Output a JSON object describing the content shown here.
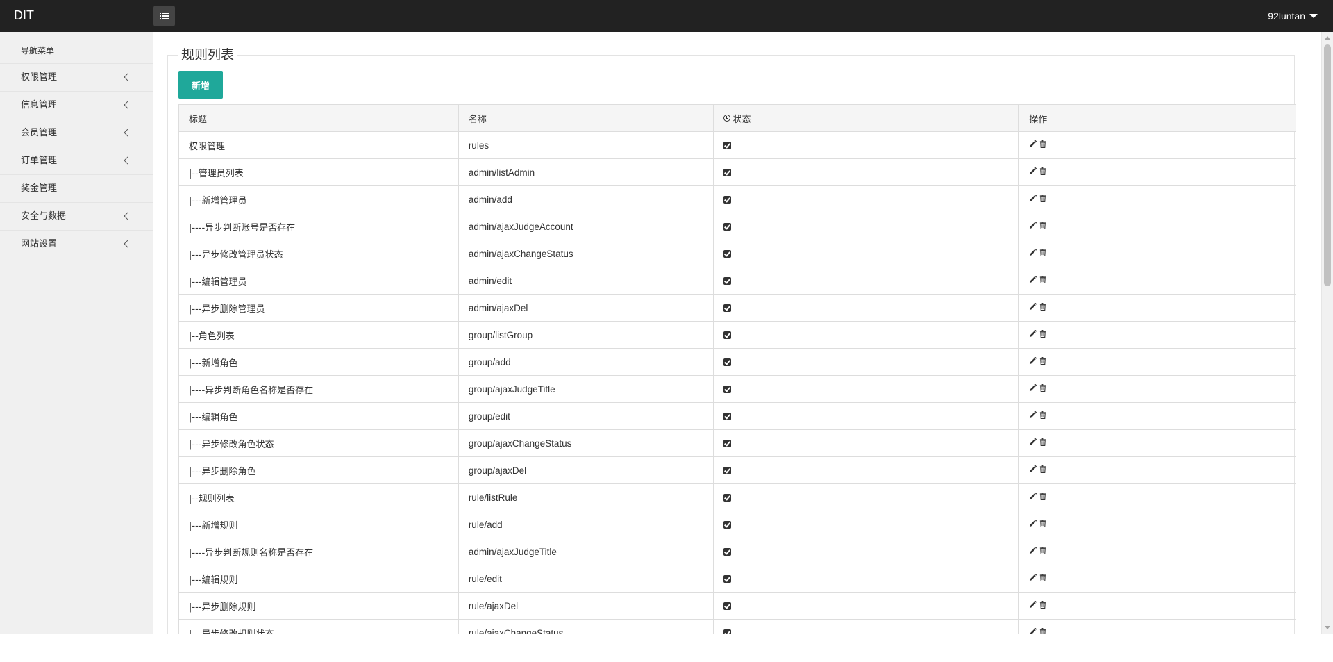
{
  "header": {
    "brand": "DIT",
    "user": "92luntan"
  },
  "sidebar": {
    "title": "导航菜单",
    "items": [
      {
        "label": "权限管理",
        "has_children": true
      },
      {
        "label": "信息管理",
        "has_children": true
      },
      {
        "label": "会员管理",
        "has_children": true
      },
      {
        "label": "订单管理",
        "has_children": true
      },
      {
        "label": "奖金管理",
        "has_children": false
      },
      {
        "label": "安全与数据",
        "has_children": true
      },
      {
        "label": "网站设置",
        "has_children": true
      }
    ]
  },
  "main": {
    "title": "规则列表",
    "add_button": "新增",
    "table": {
      "columns": [
        "标题",
        "名称",
        "状态",
        "操作"
      ],
      "rows": [
        {
          "title": "权限管理",
          "name": "rules",
          "status": true
        },
        {
          "title": "|--管理员列表",
          "name": "admin/listAdmin",
          "status": true
        },
        {
          "title": "|---新增管理员",
          "name": "admin/add",
          "status": true
        },
        {
          "title": "|----异步判断账号是否存在",
          "name": "admin/ajaxJudgeAccount",
          "status": true
        },
        {
          "title": "|---异步修改管理员状态",
          "name": "admin/ajaxChangeStatus",
          "status": true
        },
        {
          "title": "|---编辑管理员",
          "name": "admin/edit",
          "status": true
        },
        {
          "title": "|---异步删除管理员",
          "name": "admin/ajaxDel",
          "status": true
        },
        {
          "title": "|--角色列表",
          "name": "group/listGroup",
          "status": true
        },
        {
          "title": "|---新增角色",
          "name": "group/add",
          "status": true
        },
        {
          "title": "|----异步判断角色名称是否存在",
          "name": "group/ajaxJudgeTitle",
          "status": true
        },
        {
          "title": "|---编辑角色",
          "name": "group/edit",
          "status": true
        },
        {
          "title": "|---异步修改角色状态",
          "name": "group/ajaxChangeStatus",
          "status": true
        },
        {
          "title": "|---异步删除角色",
          "name": "group/ajaxDel",
          "status": true
        },
        {
          "title": "|--规则列表",
          "name": "rule/listRule",
          "status": true
        },
        {
          "title": "|---新增规则",
          "name": "rule/add",
          "status": true
        },
        {
          "title": "|----异步判断规则名称是否存在",
          "name": "admin/ajaxJudgeTitle",
          "status": true
        },
        {
          "title": "|---编辑规则",
          "name": "rule/edit",
          "status": true
        },
        {
          "title": "|---异步删除规则",
          "name": "rule/ajaxDel",
          "status": true
        },
        {
          "title": "|---异步修改规则状态",
          "name": "rule/ajaxChangeStatus",
          "status": true
        }
      ]
    }
  },
  "icons": {
    "menu_toggle": "list-icon",
    "status_header": "clock-icon",
    "status_cell": "checked-checkbox-icon",
    "edit": "pencil-icon",
    "delete": "trash-icon",
    "sidebar_expand": "chevron-left-icon",
    "user_menu": "caret-down-icon"
  },
  "colors": {
    "topbar": "#222222",
    "sidebar": "#f0f0f0",
    "primary_button": "#1fa89a"
  }
}
